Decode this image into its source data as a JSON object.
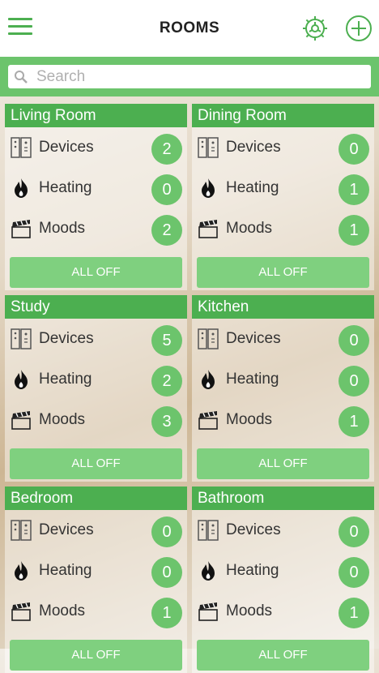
{
  "header": {
    "title": "ROOMS",
    "menu_icon": "hamburger-menu-icon",
    "settings_icon": "gear-icon",
    "add_icon": "plus-circle-icon"
  },
  "search": {
    "placeholder": "Search"
  },
  "colors": {
    "accent": "#4caf50",
    "badge": "#6cc46c",
    "button": "#7fd07f"
  },
  "rooms": [
    {
      "name": "Living Room",
      "devices_label": "Devices",
      "devices": "2",
      "heating_label": "Heating",
      "heating": "0",
      "moods_label": "Moods",
      "moods": "2",
      "button": "ALL OFF"
    },
    {
      "name": "Dining Room",
      "devices_label": "Devices",
      "devices": "0",
      "heating_label": "Heating",
      "heating": "1",
      "moods_label": "Moods",
      "moods": "1",
      "button": "ALL OFF"
    },
    {
      "name": "Study",
      "devices_label": "Devices",
      "devices": "5",
      "heating_label": "Heating",
      "heating": "2",
      "moods_label": "Moods",
      "moods": "3",
      "button": "ALL OFF"
    },
    {
      "name": "Kitchen",
      "devices_label": "Devices",
      "devices": "0",
      "heating_label": "Heating",
      "heating": "0",
      "moods_label": "Moods",
      "moods": "1",
      "button": "ALL OFF"
    },
    {
      "name": "Bedroom",
      "devices_label": "Devices",
      "devices": "0",
      "heating_label": "Heating",
      "heating": "0",
      "moods_label": "Moods",
      "moods": "1",
      "button": "ALL OFF"
    },
    {
      "name": "Bathroom",
      "devices_label": "Devices",
      "devices": "0",
      "heating_label": "Heating",
      "heating": "0",
      "moods_label": "Moods",
      "moods": "1",
      "button": "ALL OFF"
    }
  ]
}
